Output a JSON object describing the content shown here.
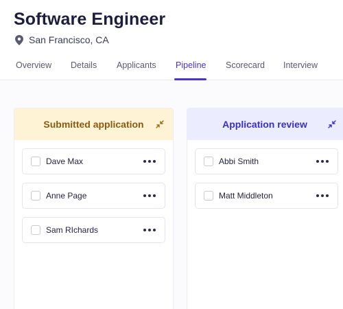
{
  "job": {
    "title": "Software Engineer",
    "location": "San Francisco, CA"
  },
  "tabs": [
    {
      "label": "Overview"
    },
    {
      "label": "Details"
    },
    {
      "label": "Applicants"
    },
    {
      "label": "Pipeline",
      "active": true
    },
    {
      "label": "Scorecard"
    },
    {
      "label": "Interview"
    }
  ],
  "columns": [
    {
      "title": "Submitted application",
      "color": "#fef4d5",
      "cards": [
        {
          "name": "Dave Max"
        },
        {
          "name": "Anne Page"
        },
        {
          "name": "Sam RIchards"
        }
      ]
    },
    {
      "title": "Application review",
      "color": "#ebecfd",
      "cards": [
        {
          "name": "Abbi Smith"
        },
        {
          "name": "Matt Middleton"
        }
      ]
    }
  ],
  "colors": {
    "accent": "#4b33c9",
    "column_yellow_text": "#8a5a12",
    "column_blue_text": "#3b2fc2"
  },
  "icons": [
    "location-pin-icon",
    "collapse-arrows-icon",
    "more-dots-icon",
    "checkbox"
  ]
}
